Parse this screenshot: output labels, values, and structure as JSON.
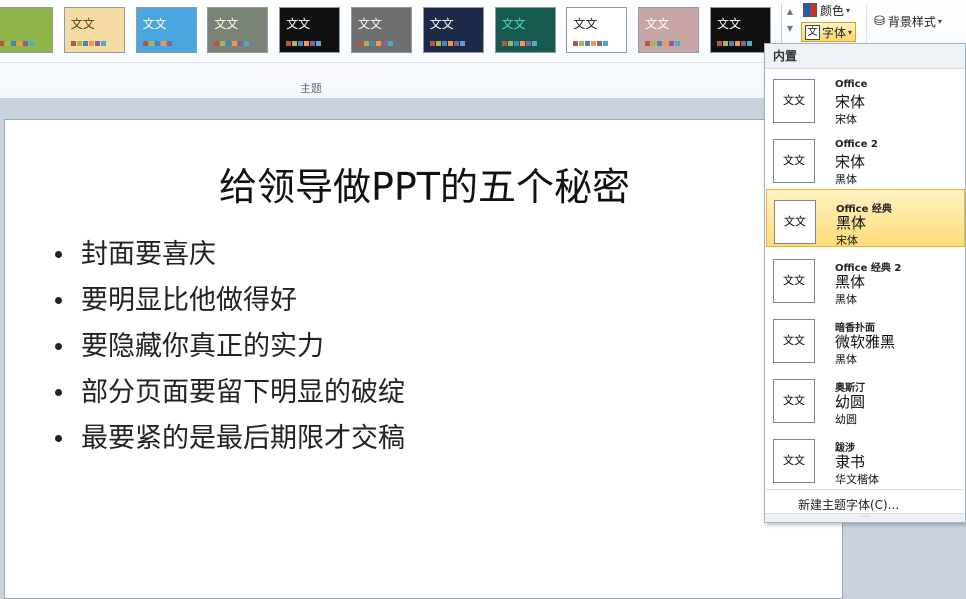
{
  "ribbon": {
    "themes": [
      {
        "label": "",
        "bg": "#8fb44a",
        "fg": "#ffffff"
      },
      {
        "label": "文文",
        "bg": "#f4dca2",
        "fg": "#5a3d10"
      },
      {
        "label": "文文",
        "bg": "#4aa6df",
        "fg": "#ffffff"
      },
      {
        "label": "文文",
        "bg": "#7a8474",
        "fg": "#ffffff"
      },
      {
        "label": "文文",
        "bg": "#111111",
        "fg": "#ffffff"
      },
      {
        "label": "文文",
        "bg": "#6e6e6e",
        "fg": "#ffffff"
      },
      {
        "label": "文文",
        "bg": "#1d2a47",
        "fg": "#ffffff"
      },
      {
        "label": "文文",
        "bg": "#165a4f",
        "fg": "#5fd7c0"
      },
      {
        "label": "文文",
        "bg": "#ffffff",
        "fg": "#222222"
      },
      {
        "label": "文文",
        "bg": "#c9a6a6",
        "fg": "#ffffff"
      },
      {
        "label": "文文",
        "bg": "#111111",
        "fg": "#ffffff"
      }
    ],
    "group_label": "主题",
    "colors_label": "颜色",
    "fonts_label": "字体",
    "bg_style_label": "背景样式",
    "accent": "#ffd56b"
  },
  "slide": {
    "title": "给领导做PPT的五个秘密",
    "bullets": [
      "封面要喜庆",
      "要明显比他做得好",
      "要隐藏你真正的实力",
      "部分页面要留下明显的破绽",
      "最要紧的是最后期限才交稿"
    ]
  },
  "font_menu": {
    "header": "内置",
    "items": [
      {
        "theme": "Office",
        "heading_font": "宋体",
        "body_font": "宋体",
        "selected": false
      },
      {
        "theme": "Office 2",
        "heading_font": "宋体",
        "body_font": "黑体",
        "selected": false
      },
      {
        "theme": "Office 经典",
        "heading_font": "黑体",
        "body_font": "宋体",
        "selected": true
      },
      {
        "theme": "Office 经典 2",
        "heading_font": "黑体",
        "body_font": "黑体",
        "selected": false
      },
      {
        "theme": "暗香扑面",
        "heading_font": "微软雅黑",
        "body_font": "黑体",
        "selected": false
      },
      {
        "theme": "奥斯汀",
        "heading_font": "幼圆",
        "body_font": "幼圆",
        "selected": false
      },
      {
        "theme": "跋涉",
        "heading_font": "隶书",
        "body_font": "华文楷体",
        "selected": false
      }
    ],
    "preview_glyph": "文文",
    "new_theme_fonts": "新建主题字体(C)..."
  }
}
